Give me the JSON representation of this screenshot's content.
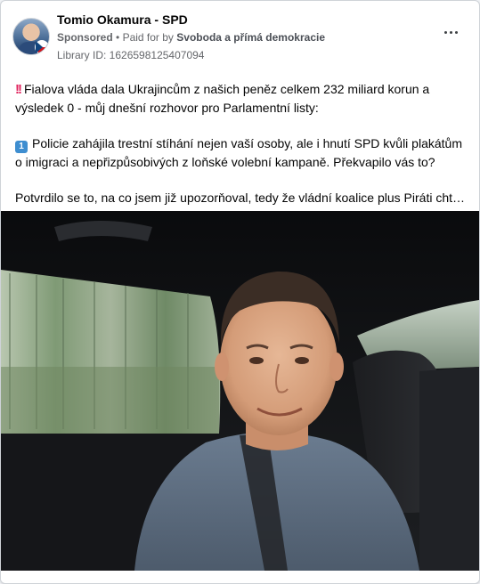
{
  "post": {
    "page_name": "Tomio Okamura - SPD",
    "sponsored_label": "Sponsored",
    "separator": "•",
    "paid_prefix": "Paid for by",
    "payer": "Svoboda a přímá demokracie",
    "library_id": "Library ID: 1626598125407094",
    "more_icon": "more-horizontal-icon"
  },
  "body": {
    "para1_emoji": "‼️",
    "para1": "Fialova vláda dala Ukrajincům z našich peněz celkem 232 miliard korun a výsledek 0 - můj dnešní rozhovor pro Parlamentní listy:",
    "para2_emoji": "1️⃣",
    "para2": "Policie zahájila trestní stíhání nejen vaší osoby, ale i hnutí SPD kvůli plakátům o imigraci a nepřizpůsobivých z loňské volební kampaně. Překvapilo vás to?",
    "para3": "Potvrdilo se to, na co jsem již upozorňoval, tedy že vládní koalice plus Piráti chtějí…"
  },
  "colors": {
    "text": "#050505",
    "meta": "#65676b",
    "card_bg": "#ffffff",
    "page_bg": "#f0f2f5"
  }
}
